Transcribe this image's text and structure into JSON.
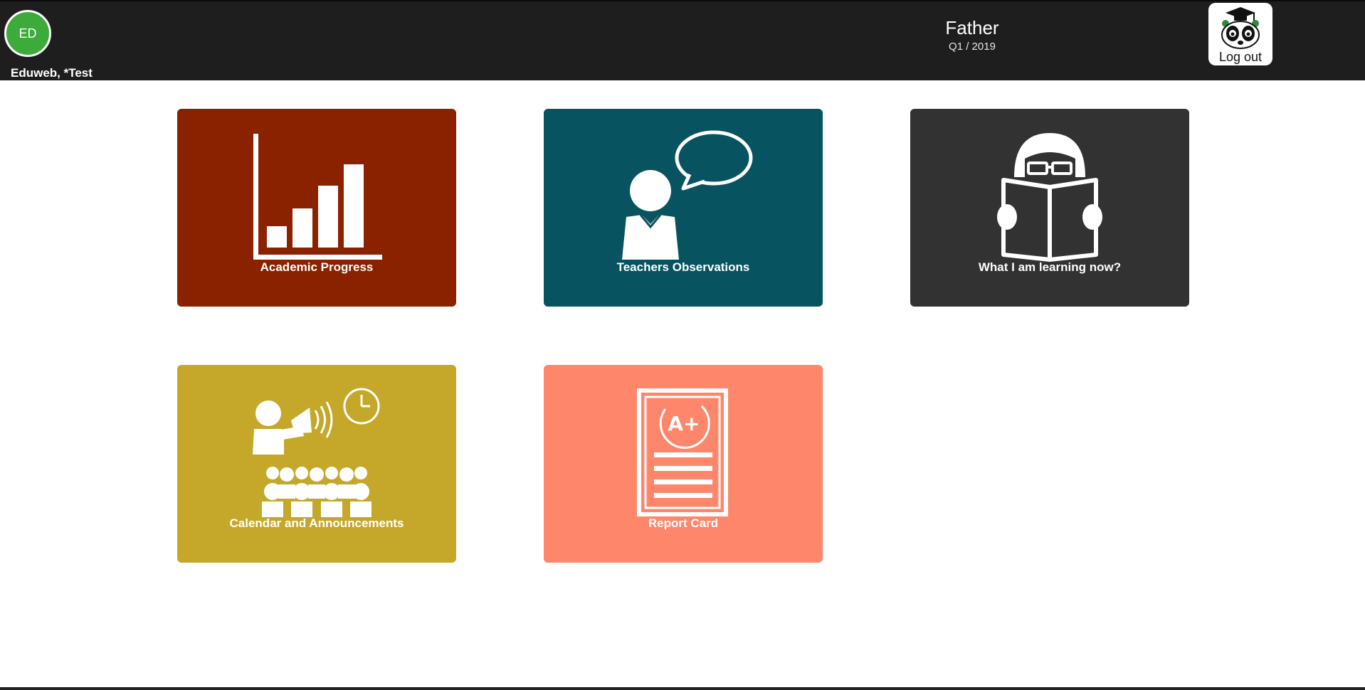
{
  "header": {
    "avatar_initials": "ED",
    "user_name": "Eduweb, *Test",
    "role": "Father",
    "period": "Q1 / 2019",
    "logout_label": "Log out"
  },
  "tiles": [
    {
      "label": "Academic Progress",
      "icon": "bar-chart-icon",
      "color": "#8a2200"
    },
    {
      "label": "Teachers Observations",
      "icon": "teacher-speech-icon",
      "color": "#07535f"
    },
    {
      "label": "What I am learning now?",
      "icon": "reading-student-icon",
      "color": "#323232"
    },
    {
      "label": "Calendar and Announcements",
      "icon": "announcement-crowd-icon",
      "color": "#c5a82a"
    },
    {
      "label": "Report Card",
      "icon": "report-card-icon",
      "color": "#fd866b"
    }
  ],
  "colors": {
    "topbar": "#1e1e1e",
    "avatar": "#3cab3a"
  }
}
